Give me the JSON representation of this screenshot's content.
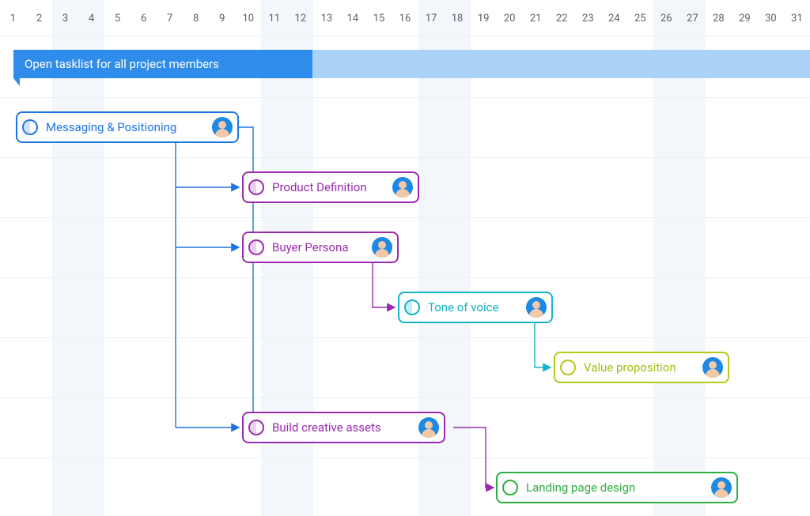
{
  "timeline": {
    "days": [
      1,
      2,
      3,
      4,
      5,
      6,
      7,
      8,
      9,
      10,
      11,
      12,
      13,
      14,
      15,
      16,
      17,
      18,
      19,
      20,
      21,
      22,
      23,
      24,
      25,
      26,
      27,
      28,
      29,
      30,
      31
    ],
    "stripeDays": [
      3,
      4,
      11,
      12,
      17,
      18,
      26,
      27
    ]
  },
  "header": {
    "label": "Open tasklist for all project members"
  },
  "tasks": {
    "messaging": {
      "label": "Messaging & Positioning"
    },
    "productDef": {
      "label": "Product Definition"
    },
    "buyerPersona": {
      "label": "Buyer Persona"
    },
    "toneVoice": {
      "label": "Tone of voice"
    },
    "valueProp": {
      "label": "Value proposition"
    },
    "creative": {
      "label": "Build creative assets"
    },
    "landing": {
      "label": "Landing  page design"
    }
  }
}
